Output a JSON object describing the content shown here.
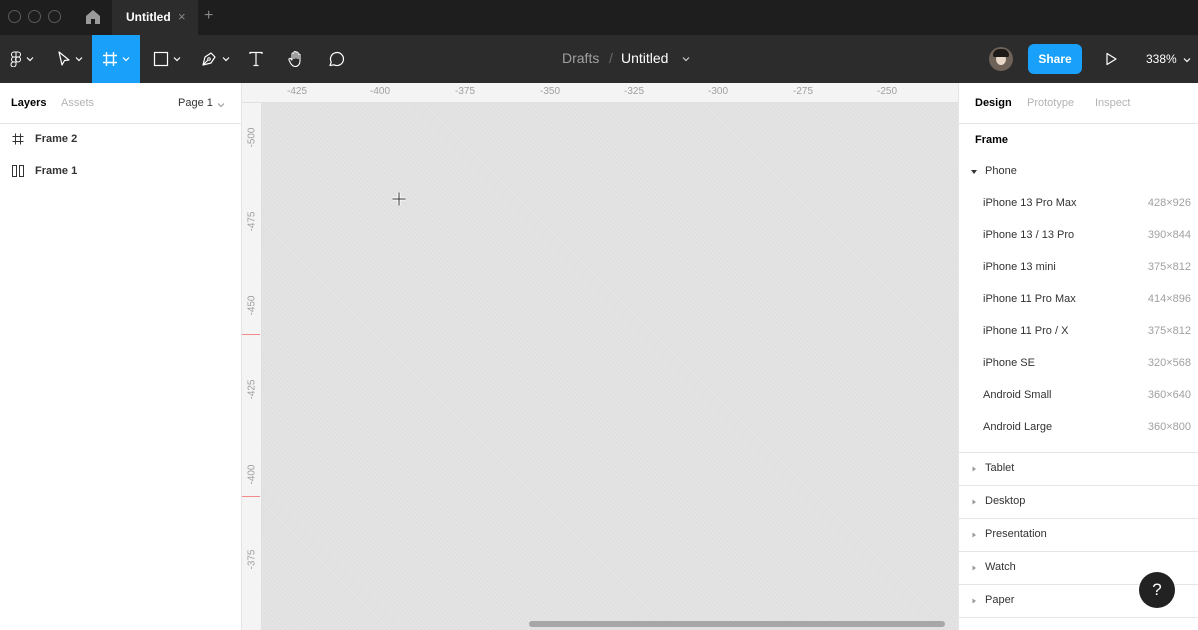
{
  "titlebar": {
    "tab_label": "Untitled",
    "tab_close": "×",
    "new_tab": "+"
  },
  "toolbar": {
    "breadcrumb_parent": "Drafts",
    "breadcrumb_sep": "/",
    "file_title": "Untitled",
    "share_label": "Share",
    "zoom_label": "338%",
    "active_tool": "frame-tool",
    "accent_color": "#18a0fb"
  },
  "left_panel": {
    "tabs": [
      {
        "label": "Layers"
      },
      {
        "label": "Assets"
      }
    ],
    "page_label": "Page 1",
    "layers": [
      {
        "label": "Frame 2",
        "icon": "frame-icon"
      },
      {
        "label": "Frame 1",
        "icon": "columns-frame-icon"
      }
    ]
  },
  "rulers": {
    "top_ticks": [
      "-425",
      "-400",
      "-375",
      "-350",
      "-325",
      "-300",
      "-275",
      "-250"
    ],
    "left_ticks": [
      "-500",
      "-475",
      "-450",
      "-425",
      "-400",
      "-375"
    ]
  },
  "right_panel": {
    "tabs": [
      {
        "label": "Design"
      },
      {
        "label": "Prototype"
      },
      {
        "label": "Inspect"
      }
    ],
    "section_title": "Frame",
    "expanded_group": "Phone",
    "presets": [
      {
        "name": "iPhone 13 Pro Max",
        "size": "428×926"
      },
      {
        "name": "iPhone 13 / 13 Pro",
        "size": "390×844"
      },
      {
        "name": "iPhone 13 mini",
        "size": "375×812"
      },
      {
        "name": "iPhone 11 Pro Max",
        "size": "414×896"
      },
      {
        "name": "iPhone 11 Pro / X",
        "size": "375×812"
      },
      {
        "name": "iPhone SE",
        "size": "320×568"
      },
      {
        "name": "Android Small",
        "size": "360×640"
      },
      {
        "name": "Android Large",
        "size": "360×800"
      }
    ],
    "collapsed_groups": [
      "Tablet",
      "Desktop",
      "Presentation",
      "Watch",
      "Paper"
    ],
    "help_label": "?"
  }
}
